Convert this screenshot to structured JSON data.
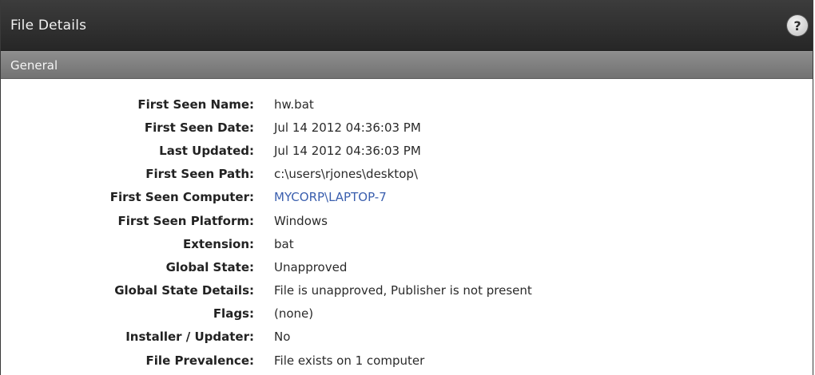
{
  "panel": {
    "title": "File Details",
    "help_icon": "help-icon",
    "section": "General"
  },
  "details": [
    {
      "label": "First Seen Name:",
      "value": "hw.bat"
    },
    {
      "label": "First Seen Date:",
      "value": "Jul 14 2012 04:36:03 PM"
    },
    {
      "label": "Last Updated:",
      "value": "Jul 14 2012 04:36:03 PM"
    },
    {
      "label": "First Seen Path:",
      "value": "c:\\users\\rjones\\desktop\\"
    },
    {
      "label": "First Seen Computer:",
      "value": "MYCORP\\LAPTOP-7"
    },
    {
      "label": "First Seen Platform:",
      "value": "Windows"
    },
    {
      "label": "Extension:",
      "value": "bat"
    },
    {
      "label": "Global State:",
      "value": "Unapproved"
    },
    {
      "label": "Global State Details:",
      "value": "File is unapproved, Publisher is not present"
    },
    {
      "label": "Flags:",
      "value": "(none)"
    },
    {
      "label": "Installer / Updater:",
      "value": "No"
    },
    {
      "label": "File Prevalence:",
      "value": "File exists on 1 computer"
    }
  ],
  "colors": {
    "title_bar": "#2e2e2e",
    "section_bar": "#808080",
    "link": "#3b5fae"
  }
}
